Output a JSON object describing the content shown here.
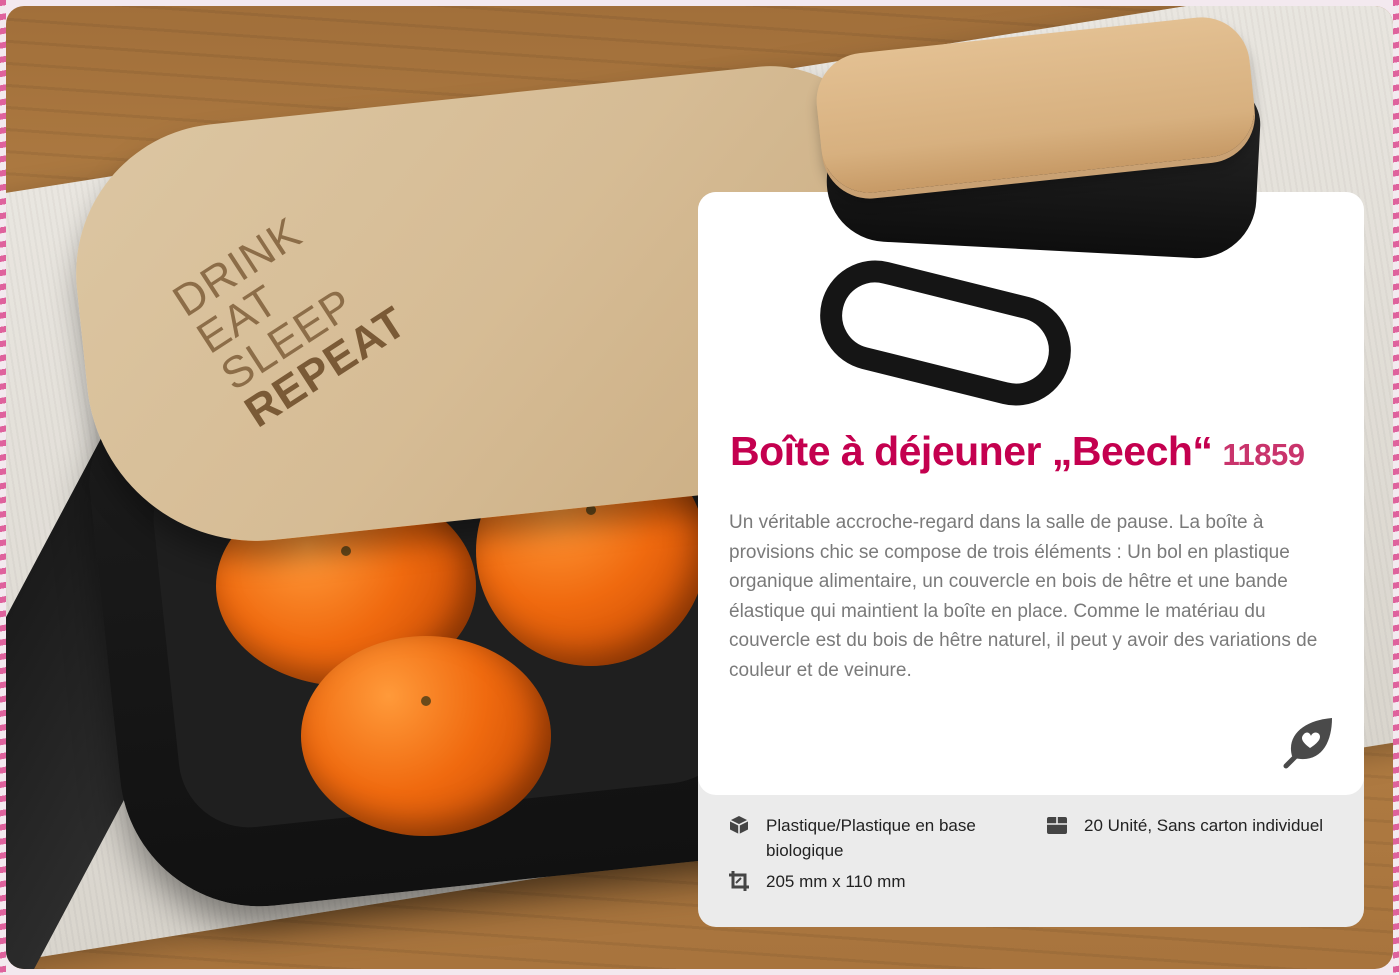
{
  "hero": {
    "engraving": [
      "DRINK",
      "EAT",
      "SLEEP",
      "REPEAT"
    ]
  },
  "product": {
    "title": "Boîte à déjeuner „Beech“",
    "article_number": "11859",
    "description": "Un véritable accroche-regard dans la salle de pause. La boîte à provisions chic se compose de trois éléments : Un bol en plastique organique alimentaire, un couvercle en bois de hêtre et une bande élastique qui maintient la boîte en place. Comme le matériau du couvercle est du bois de hêtre naturel, il peut y avoir des variations de couleur et de veinure.",
    "eco_badge_icon": "leaf-heart-icon"
  },
  "specs": {
    "material": {
      "icon": "box-icon",
      "text": "Plastique/Plastique en base biologique"
    },
    "packaging": {
      "icon": "carton-icon",
      "text": "20 Unité, Sans carton individuel"
    },
    "dimensions": {
      "icon": "crop-dimensions-icon",
      "text": "205 mm x 110 mm"
    }
  },
  "colors": {
    "accent": "#c4004f",
    "card_bottom": "#ebebeb"
  }
}
